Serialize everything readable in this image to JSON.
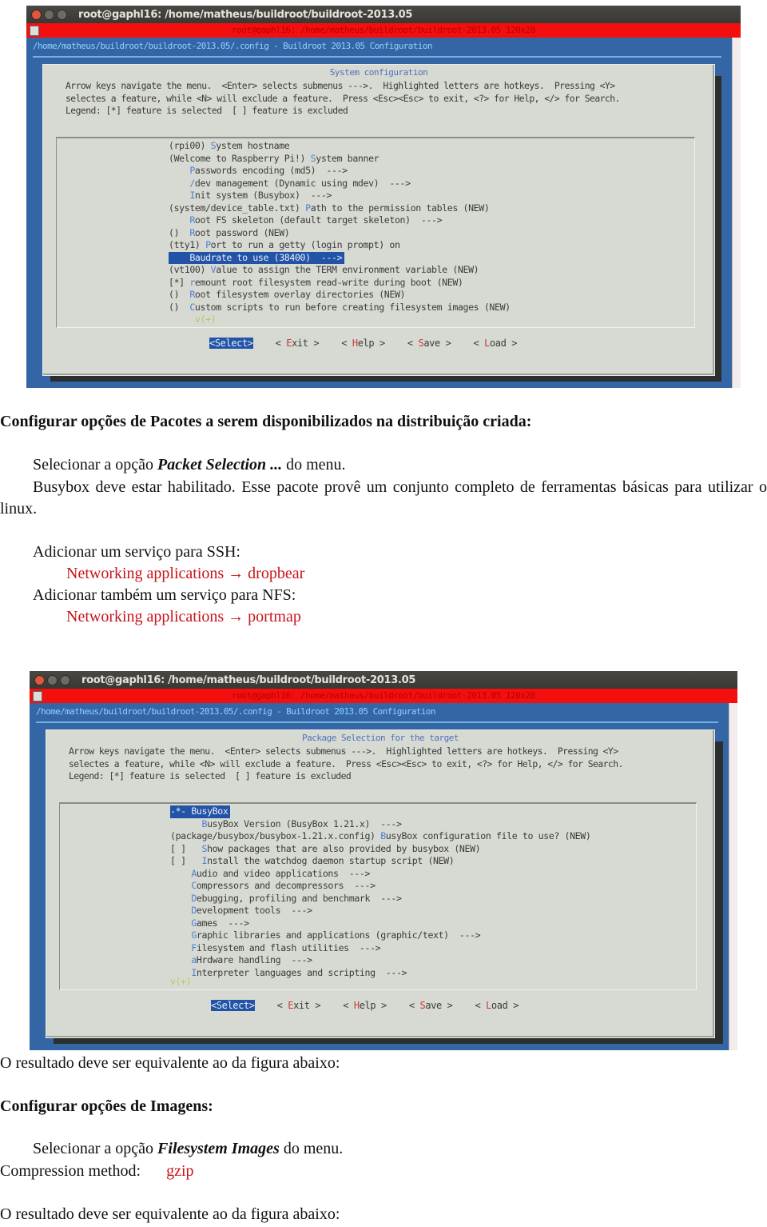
{
  "window_controls": [
    "close",
    "minimize",
    "maximize"
  ],
  "screenshot1": {
    "window_title": "root@gaphl16: /home/matheus/buildroot/buildroot-2013.05",
    "tab_title": "root@gaphl16: /home/matheus/buildroot/buildroot-2013.05 120x28",
    "config_path": "/home/matheus/buildroot/buildroot-2013.05/.config - Buildroot 2013.05 Configuration",
    "dialog_title": "System configuration",
    "help_lines": [
      "Arrow keys navigate the menu.  <Enter> selects submenus --->.  Highlighted letters are hotkeys.  Pressing <Y>",
      "selectes a feature, while <N> will exclude a feature.  Press <Esc><Esc> to exit, <?> for Help, </> for Search.",
      "Legend: [*] feature is selected  [ ] feature is excluded"
    ],
    "menu_items": [
      {
        "prefix": "(rpi00) ",
        "hotkey": "S",
        "rest": "ystem hostname"
      },
      {
        "prefix": "(Welcome to Raspberry Pi!) ",
        "hotkey": "S",
        "rest": "ystem banner"
      },
      {
        "prefix": "    ",
        "hotkey": "P",
        "rest": "asswords encoding (md5)  --->"
      },
      {
        "prefix": "    ",
        "hotkey": "/",
        "rest": "dev management (Dynamic using mdev)  --->"
      },
      {
        "prefix": "    ",
        "hotkey": "I",
        "rest": "nit system (Busybox)  --->"
      },
      {
        "prefix": "(system/device_table.txt) ",
        "hotkey": "P",
        "rest": "ath to the permission tables (NEW)"
      },
      {
        "prefix": "    ",
        "hotkey": "R",
        "rest": "oot FS skeleton (default target skeleton)  --->"
      },
      {
        "prefix": "()  ",
        "hotkey": "R",
        "rest": "oot password (NEW)"
      },
      {
        "prefix": "(tty1) ",
        "hotkey": "P",
        "rest": "ort to run a getty (login prompt) on"
      },
      {
        "prefix": "    ",
        "hotkey": "B",
        "rest": "audrate to use (38400)  --->",
        "selected": true
      },
      {
        "prefix": "(vt100) ",
        "hotkey": "V",
        "rest": "alue to assign the TERM environment variable (NEW)"
      },
      {
        "prefix": "[*] ",
        "hotkey": "r",
        "rest": "emount root filesystem read-write during boot (NEW)"
      },
      {
        "prefix": "()  ",
        "hotkey": "R",
        "rest": "oot filesystem overlay directories (NEW)"
      },
      {
        "prefix": "()  ",
        "hotkey": "C",
        "rest": "ustom scripts to run before creating filesystem images (NEW)"
      }
    ],
    "more_indicator": "v(+)",
    "buttons": [
      {
        "label": "<Select>",
        "selected": true
      },
      {
        "label": "< Exit >"
      },
      {
        "label": "< Help >"
      },
      {
        "label": "< Save >"
      },
      {
        "label": "< Load >"
      }
    ]
  },
  "section1": {
    "heading": "Configurar opções de Pacotes a serem disponibilizados na distribuição criada:",
    "p1_before": "Selecionar a opção ",
    "p1_emph": "Packet Selection ...",
    "p1_after": " do menu.",
    "p2": "Busybox deve estar habilitado. Esse pacote provê um conjunto completo de ferramentas básicas para utilizar o linux.",
    "ssh_label": "Adicionar um serviço para SSH:",
    "ssh_path": "Networking applications → dropbear",
    "nfs_label": "Adicionar também um serviço para NFS:",
    "nfs_path": "Networking applications → portmap"
  },
  "screenshot2": {
    "window_title": "root@gaphl16: /home/matheus/buildroot/buildroot-2013.05",
    "tab_title": "root@gaphl16: /home/matheus/buildroot/buildroot-2013.05 120x28",
    "config_path": "/home/matheus/buildroot/buildroot-2013.05/.config - Buildroot 2013.05 Configuration",
    "dialog_title": "Package Selection for the target",
    "help_lines": [
      "Arrow keys navigate the menu.  <Enter> selects submenus --->.  Highlighted letters are hotkeys.  Pressing <Y>",
      "selectes a feature, while <N> will exclude a feature.  Press <Esc><Esc> to exit, <?> for Help, </> for Search.",
      "Legend: [*] feature is selected  [ ] feature is excluded"
    ],
    "menu_items": [
      {
        "prefix": "-*- ",
        "hotkey": "B",
        "rest": "usyBox",
        "selected": true
      },
      {
        "prefix": "      ",
        "hotkey": "B",
        "rest": "usyBox Version (BusyBox 1.21.x)  --->"
      },
      {
        "prefix": "(package/busybox/busybox-1.21.x.config) ",
        "hotkey": "B",
        "rest": "usyBox configuration file to use? (NEW)"
      },
      {
        "prefix": "[ ]   ",
        "hotkey": "S",
        "rest": "how packages that are also provided by busybox (NEW)"
      },
      {
        "prefix": "[ ]   ",
        "hotkey": "I",
        "rest": "nstall the watchdog daemon startup script (NEW)"
      },
      {
        "prefix": "    ",
        "hotkey": "A",
        "rest": "udio and video applications  --->"
      },
      {
        "prefix": "    ",
        "hotkey": "C",
        "rest": "ompressors and decompressors  --->"
      },
      {
        "prefix": "    ",
        "hotkey": "D",
        "rest": "ebugging, profiling and benchmark  --->"
      },
      {
        "prefix": "    ",
        "hotkey": "D",
        "rest": "evelopment tools  --->"
      },
      {
        "prefix": "    ",
        "hotkey": "G",
        "rest": "ames  --->"
      },
      {
        "prefix": "    ",
        "hotkey": "G",
        "rest": "raphic libraries and applications (graphic/text)  --->"
      },
      {
        "prefix": "    ",
        "hotkey": "F",
        "rest": "ilesystem and flash utilities  --->"
      },
      {
        "prefix": "    ",
        "hotkey": "a",
        "rest": "Hrdware handling  --->"
      },
      {
        "prefix": "    ",
        "hotkey": "I",
        "rest": "nterpreter languages and scripting  --->"
      }
    ],
    "more_indicator": "v(+)",
    "buttons": [
      {
        "label": "<Select>",
        "selected": true
      },
      {
        "label": "< Exit >"
      },
      {
        "label": "< Help >"
      },
      {
        "label": "< Save >"
      },
      {
        "label": "< Load >"
      }
    ]
  },
  "result1": "O resultado deve ser equivalente ao da figura abaixo:",
  "section2": {
    "heading": "Configurar opções de Imagens:",
    "p1_before": "Selecionar a opção ",
    "p1_emph": "Filesystem Images",
    "p1_after": " do menu.",
    "compression_label": "Compression method:",
    "compression_value": "gzip"
  },
  "result2": "O resultado deve ser equivalente ao da figura abaixo:",
  "colors": {
    "accent_red": "#c8141b",
    "terminal_blue": "#3466a6",
    "tab_red": "#f40f0f",
    "selection_blue": "#2253a6",
    "dialog_gray": "#d7d9d3"
  }
}
